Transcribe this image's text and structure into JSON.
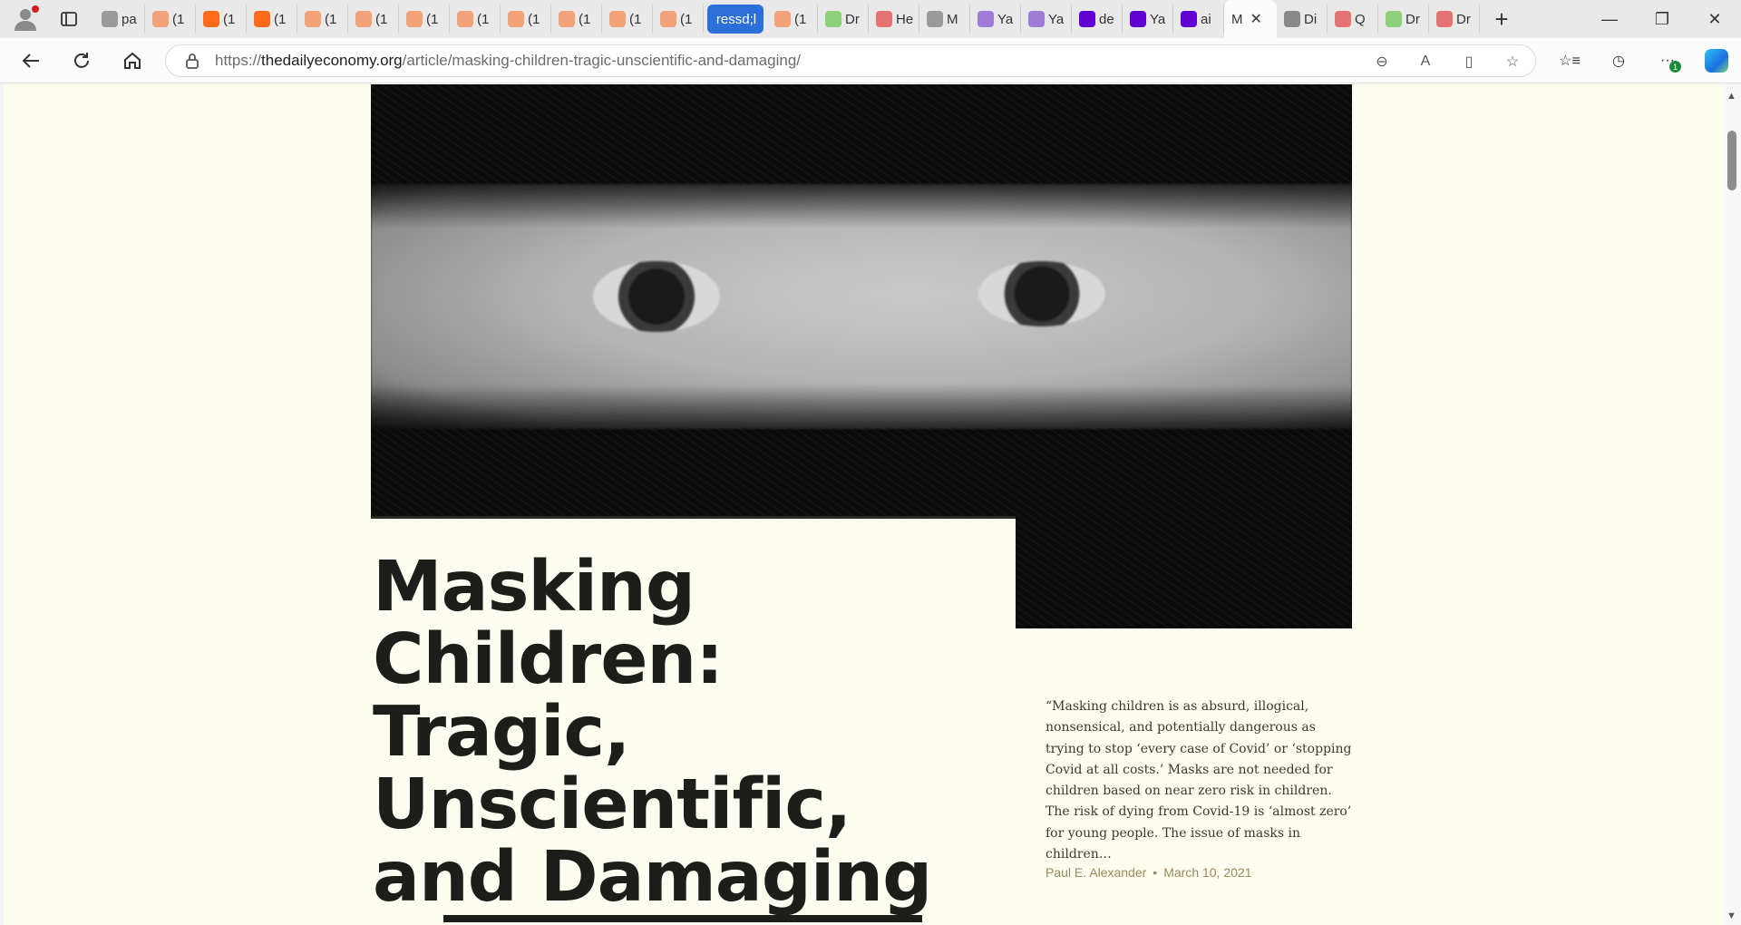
{
  "browser": {
    "tabs": [
      {
        "label": "pa",
        "favicon": "page-icon",
        "color": "#9a9a9a"
      },
      {
        "label": "(1",
        "favicon": "bookmark-icon",
        "color": "#f3a37a"
      },
      {
        "label": "(1",
        "favicon": "bookmark-icon",
        "color": "#ff6b1a"
      },
      {
        "label": "(1",
        "favicon": "bookmark-icon",
        "color": "#ff6b1a"
      },
      {
        "label": "(1",
        "favicon": "bookmark-icon",
        "color": "#f3a37a"
      },
      {
        "label": "(1",
        "favicon": "bookmark-icon",
        "color": "#f3a37a"
      },
      {
        "label": "(1",
        "favicon": "bookmark-icon",
        "color": "#f3a37a"
      },
      {
        "label": "(1",
        "favicon": "bookmark-icon",
        "color": "#f3a37a"
      },
      {
        "label": "(1",
        "favicon": "bookmark-icon",
        "color": "#f3a37a"
      },
      {
        "label": "(1",
        "favicon": "bookmark-icon",
        "color": "#f3a37a"
      },
      {
        "label": "(1",
        "favicon": "bookmark-icon",
        "color": "#f3a37a"
      },
      {
        "label": "(1",
        "favicon": "bookmark-icon",
        "color": "#f3a37a"
      }
    ],
    "special_tab": "ressd;l",
    "tabs_after": [
      {
        "label": "(1",
        "favicon": "bookmark-icon",
        "color": "#f3a37a"
      },
      {
        "label": "Dr",
        "favicon": "play-icon",
        "color": "#8cd07a"
      },
      {
        "label": "He",
        "favicon": "mic-icon",
        "color": "#e57373"
      },
      {
        "label": "M",
        "favicon": "search-icon",
        "color": "#9a9a9a"
      },
      {
        "label": "Ya",
        "favicon": "yahoo-icon",
        "color": "#a07cd8"
      },
      {
        "label": "Ya",
        "favicon": "yahoo-icon",
        "color": "#a07cd8"
      },
      {
        "label": "de",
        "favicon": "yahoo-icon",
        "color": "#6001d2"
      },
      {
        "label": "Ya",
        "favicon": "yahoo-icon",
        "color": "#6001d2"
      },
      {
        "label": "ai",
        "favicon": "yahoo-icon",
        "color": "#6001d2"
      }
    ],
    "active_tab": "M",
    "tabs_end": [
      {
        "label": "Di",
        "favicon": "slash-icon",
        "color": "#888888"
      },
      {
        "label": "Q",
        "favicon": "youtube-icon",
        "color": "#e57373"
      },
      {
        "label": "Dr",
        "favicon": "play-icon",
        "color": "#8cd07a"
      },
      {
        "label": "Dr",
        "favicon": "youtube-icon",
        "color": "#e57373"
      }
    ],
    "url_prefix": "https://",
    "url_domain": "thedailyeconomy.org",
    "url_path": "/article/masking-children-tragic-unscientific-and-damaging/",
    "notification_count": "1"
  },
  "article": {
    "title": "Masking Children: Tragic, Unscientific, and Damaging",
    "excerpt": "“Masking children is as absurd, illogical, nonsensical, and potentially dangerous as trying to stop ‘every case of Covid’ or ‘stopping Covid at all costs.’ Masks are not needed for children based on near zero risk in children. The risk of dying from Covid-19 is ‘almost zero’ for young people. The issue of masks in children…",
    "author": "Paul E. Alexander",
    "separator": "•",
    "date": "March 10, 2021"
  },
  "colors": {
    "page_bg": "#fdfdf0",
    "title_text": "#1d1d1b",
    "byline": "#9a8a5a",
    "special_tab": "#2d6fd8"
  }
}
